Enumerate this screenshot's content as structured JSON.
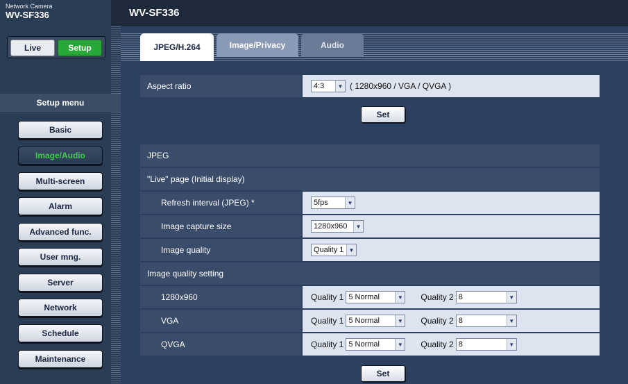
{
  "brand": {
    "subtitle": "Network Camera",
    "model": "WV-SF336"
  },
  "page_title": "WV-SF336",
  "mode_buttons": {
    "live": "Live",
    "setup": "Setup"
  },
  "setup_menu": {
    "title": "Setup menu",
    "items": [
      {
        "label": "Basic",
        "active": false
      },
      {
        "label": "Image/Audio",
        "active": true
      },
      {
        "label": "Multi-screen",
        "active": false
      },
      {
        "label": "Alarm",
        "active": false
      },
      {
        "label": "Advanced func.",
        "active": false
      },
      {
        "label": "User mng.",
        "active": false
      },
      {
        "label": "Server",
        "active": false
      },
      {
        "label": "Network",
        "active": false
      },
      {
        "label": "Schedule",
        "active": false
      },
      {
        "label": "Maintenance",
        "active": false
      }
    ]
  },
  "tabs": [
    {
      "label": "JPEG/H.264",
      "selected": true
    },
    {
      "label": "Image/Privacy",
      "selected": false
    },
    {
      "label": "Audio",
      "selected": false
    }
  ],
  "aspect": {
    "label": "Aspect ratio",
    "value": "4:3",
    "note": "( 1280x960 / VGA / QVGA )",
    "set_label": "Set"
  },
  "jpeg": {
    "section_title": "JPEG",
    "live_section": "\"Live\" page (Initial display)",
    "refresh": {
      "label": "Refresh interval (JPEG) *",
      "value": "5fps"
    },
    "capture_size": {
      "label": "Image capture size",
      "value": "1280x960"
    },
    "quality": {
      "label": "Image quality",
      "value": "Quality 1"
    },
    "quality_setting_title": "Image quality setting",
    "quality_label_1": "Quality 1",
    "quality_label_2": "Quality 2",
    "rows": [
      {
        "label": "1280x960",
        "q1": "5 Normal",
        "q2": "8"
      },
      {
        "label": "VGA",
        "q1": "5 Normal",
        "q2": "8"
      },
      {
        "label": "QVGA",
        "q1": "5 Normal",
        "q2": "8"
      }
    ],
    "set_label": "Set"
  },
  "colors": {
    "active_green": "#28a838",
    "active_text": "#3cd048",
    "navy": "#2b3c55"
  }
}
